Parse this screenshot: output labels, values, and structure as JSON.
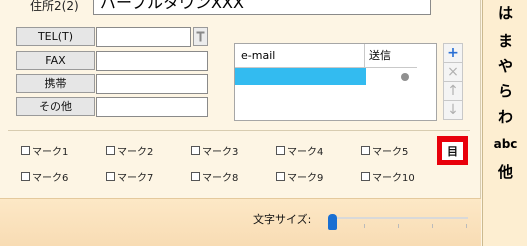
{
  "address": {
    "label": "住所2(2)",
    "value": "パープルタウンXXX"
  },
  "contact_rows": [
    {
      "label": "TEL(T)",
      "value": ""
    },
    {
      "label": "FAX",
      "value": ""
    },
    {
      "label": "携帯",
      "value": ""
    },
    {
      "label": "その他",
      "value": ""
    }
  ],
  "email_table": {
    "col_email": "e-mail",
    "col_send": "送信"
  },
  "side_buttons": {
    "add": "+",
    "remove": "×",
    "up": "↑",
    "down": "↓"
  },
  "marks": [
    "マーク1",
    "マーク2",
    "マーク3",
    "マーク4",
    "マーク5",
    "マーク6",
    "マーク7",
    "マーク8",
    "マーク9",
    "マーク10"
  ],
  "list_button_label": "目",
  "font_size": {
    "label": "文字サイズ:",
    "value": 0.0
  },
  "kana_index": [
    "は",
    "ま",
    "や",
    "ら",
    "わ",
    "abc",
    "他"
  ],
  "colors": {
    "selection": "#33bbf0",
    "highlight": "#e8000b",
    "slider": "#1a6fd2"
  }
}
